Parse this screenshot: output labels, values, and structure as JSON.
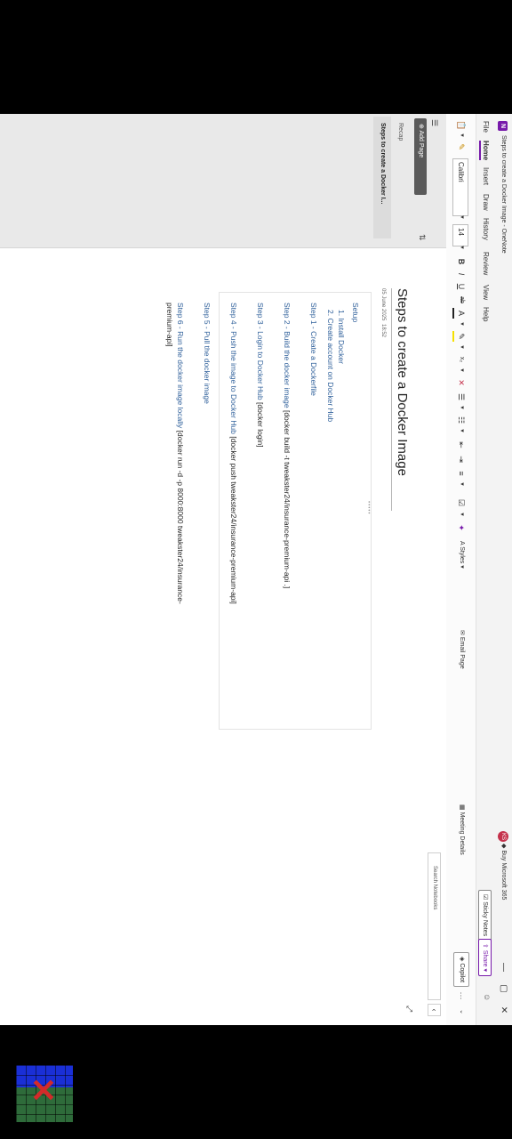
{
  "window": {
    "title": "Steps to create a Docker Image - OneNote",
    "buy": "Buy Microsoft 365",
    "avatar_initials": "KS",
    "controls": [
      "—",
      "▢",
      "✕"
    ]
  },
  "menu": {
    "tabs": [
      "File",
      "Home",
      "Insert",
      "Draw",
      "History",
      "Review",
      "View",
      "Help"
    ],
    "active": "Home",
    "sticky_notes": "Sticky Notes",
    "share": "Share"
  },
  "ribbon": {
    "font": "Calibri",
    "size": "14",
    "styles": "Styles",
    "email_page": "Email Page",
    "meeting_details": "Meeting Details",
    "copilot": "Copilot",
    "more": "···"
  },
  "sidebar": {
    "add_page": "Add Page",
    "pages": [
      "Recap",
      "Steps to create a Docker I..."
    ],
    "search_placeholder": "Search Notebooks"
  },
  "page": {
    "title": "Steps to create a Docker Image",
    "date": "05 June 2025",
    "time": "18:52",
    "setup": "Setup",
    "list": [
      "1.  Install Docker",
      "2.  Create account on Docker Hub"
    ],
    "step1": "Step 1 - Create a Dockerfile",
    "step2": "Step 2 - Build the docker image",
    "step2_cmd": "[docker build -t tweakster24/insurance-premium-api .]",
    "step3": "Step 3 - Login to Docker Hub",
    "step3_cmd": "[docker login]",
    "step4": "Step 4 - Push the image to Docker Hub",
    "step4_cmd": "[docker push tweakster24/insurance-premium-api]",
    "step5": "Step 5 - Pull the docker image",
    "step6": "Step 6 - Run the docker image locally",
    "step6_cmd": "[docker run -d -p 8000:8000 tweakster24/insurance-",
    "step6_cmd2": "premium-api]"
  }
}
